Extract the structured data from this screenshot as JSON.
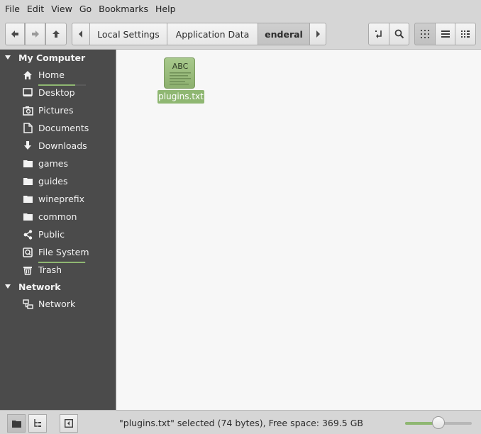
{
  "menubar": {
    "items": [
      "File",
      "Edit",
      "View",
      "Go",
      "Bookmarks",
      "Help"
    ]
  },
  "toolbar": {
    "back_icon": "arrow-left-icon",
    "forward_icon": "arrow-right-icon",
    "up_icon": "arrow-up-icon",
    "breadcrumbs": [
      "Local Settings",
      "Application Data",
      "enderal"
    ],
    "active_crumb": "enderal",
    "view_mode": "icons"
  },
  "sidebar": {
    "sections": [
      {
        "title": "My Computer",
        "items": [
          {
            "label": "Home",
            "icon": "home-icon",
            "usage": 0.78
          },
          {
            "label": "Desktop",
            "icon": "desktop-icon"
          },
          {
            "label": "Pictures",
            "icon": "camera-icon"
          },
          {
            "label": "Documents",
            "icon": "document-icon"
          },
          {
            "label": "Downloads",
            "icon": "download-icon"
          },
          {
            "label": "games",
            "icon": "folder-icon"
          },
          {
            "label": "guides",
            "icon": "folder-icon"
          },
          {
            "label": "wineprefix",
            "icon": "folder-icon"
          },
          {
            "label": "common",
            "icon": "folder-icon"
          },
          {
            "label": "Public",
            "icon": "share-icon"
          },
          {
            "label": "File System",
            "icon": "drive-icon",
            "usage": 0.98
          },
          {
            "label": "Trash",
            "icon": "trash-icon"
          }
        ]
      },
      {
        "title": "Network",
        "items": [
          {
            "label": "Network",
            "icon": "network-icon"
          }
        ]
      }
    ]
  },
  "content": {
    "files": [
      {
        "name": "plugins.txt",
        "icon_text": "ABC",
        "selected": true
      }
    ]
  },
  "statusbar": {
    "text": "\"plugins.txt\" selected (74 bytes), Free space: 369.5 GB",
    "zoom_fraction": 0.5
  },
  "colors": {
    "accent": "#8fb772",
    "sidebar_bg": "#4b4b4b",
    "content_bg": "#f7f7f7"
  }
}
